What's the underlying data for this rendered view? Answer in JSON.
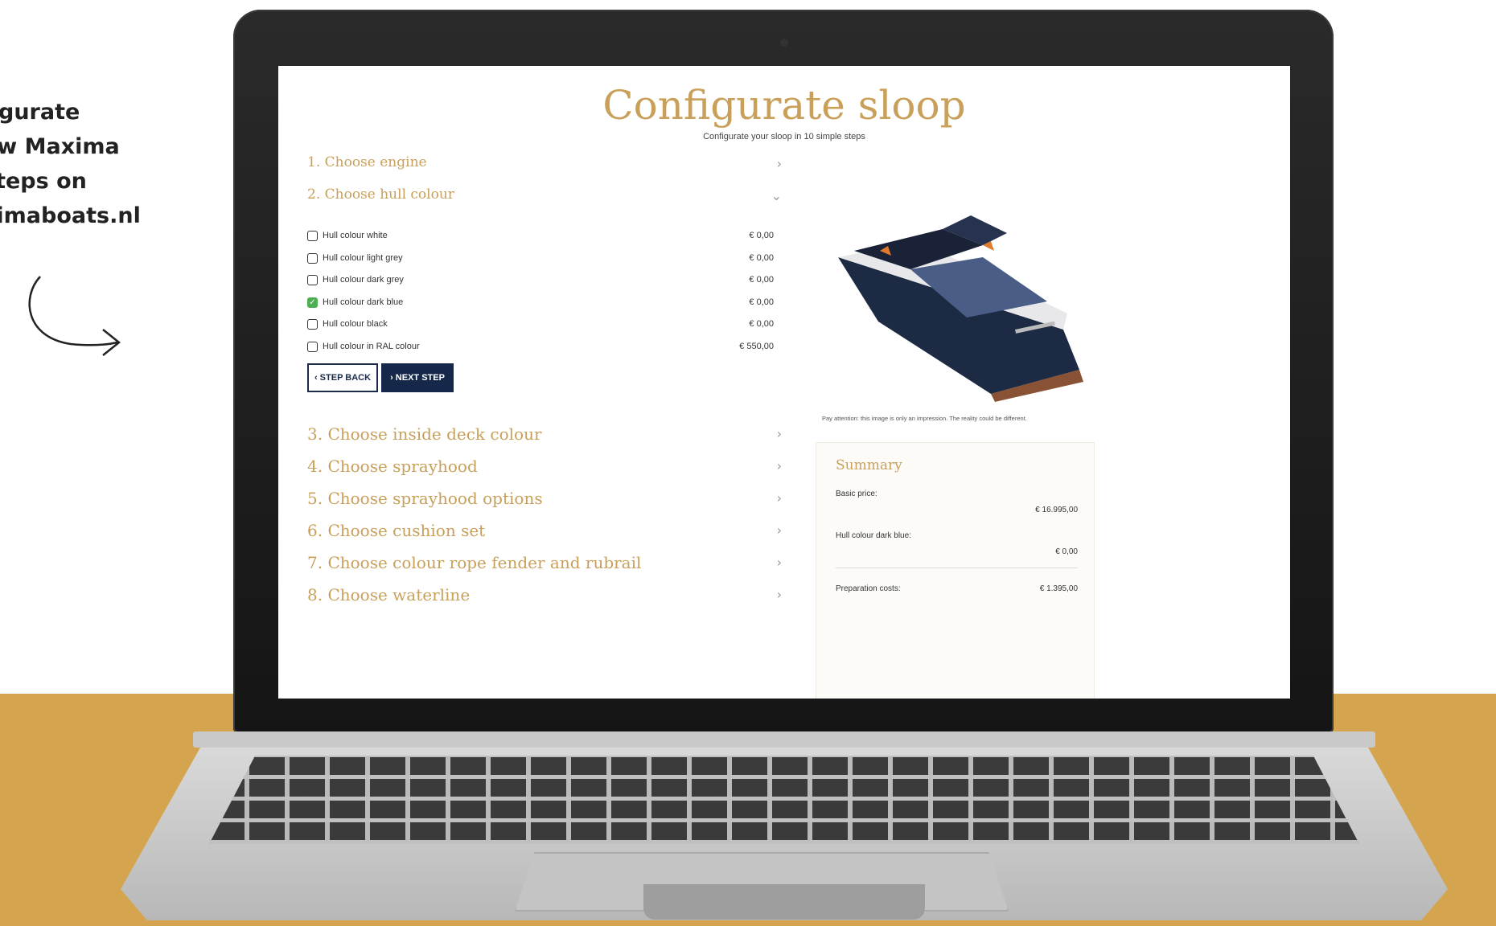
{
  "promo": {
    "lines": [
      "figurate",
      "ew Maxima",
      "steps on",
      "ximaboats.nl"
    ]
  },
  "page": {
    "title": "Configurate sloop",
    "subtitle": "Configurate your sloop in 10 simple steps"
  },
  "steps": [
    {
      "label": "1. Choose engine",
      "icon": "chevron-right-icon"
    },
    {
      "label": "2. Choose hull colour",
      "icon": "chevron-down-icon"
    },
    {
      "label": "3. Choose inside deck colour",
      "icon": "chevron-right-icon"
    },
    {
      "label": "4. Choose sprayhood",
      "icon": "chevron-right-icon"
    },
    {
      "label": "5. Choose sprayhood options",
      "icon": "chevron-right-icon"
    },
    {
      "label": "6. Choose cushion set",
      "icon": "chevron-right-icon"
    },
    {
      "label": "7. Choose colour rope fender and rubrail",
      "icon": "chevron-right-icon"
    },
    {
      "label": "8. Choose waterline",
      "icon": "chevron-right-icon"
    }
  ],
  "hull_options": [
    {
      "label": "Hull colour white",
      "price": "€ 0,00",
      "checked": false
    },
    {
      "label": "Hull colour light grey",
      "price": "€ 0,00",
      "checked": false
    },
    {
      "label": "Hull colour dark grey",
      "price": "€ 0,00",
      "checked": false
    },
    {
      "label": "Hull colour dark blue",
      "price": "€ 0,00",
      "checked": true
    },
    {
      "label": "Hull colour black",
      "price": "€ 0,00",
      "checked": false
    },
    {
      "label": "Hull colour in RAL colour",
      "price": "€ 550,00",
      "checked": false
    }
  ],
  "buttons": {
    "back": "‹ STEP BACK",
    "next": "› NEXT STEP"
  },
  "disclaimer": "Pay attention: this image is only an impression. The reality could be different.",
  "summary": {
    "title": "Summary",
    "basic_label": "Basic price:",
    "basic_value": "€ 16.995,00",
    "hull_label": "Hull colour dark blue:",
    "hull_value": "€ 0,00",
    "prep_label": "Preparation costs:",
    "prep_value": "€ 1.395,00"
  },
  "colors": {
    "accent_gold": "#c9a05a",
    "navy": "#16284a",
    "table": "#d4a54e",
    "check_green": "#4caf50"
  }
}
